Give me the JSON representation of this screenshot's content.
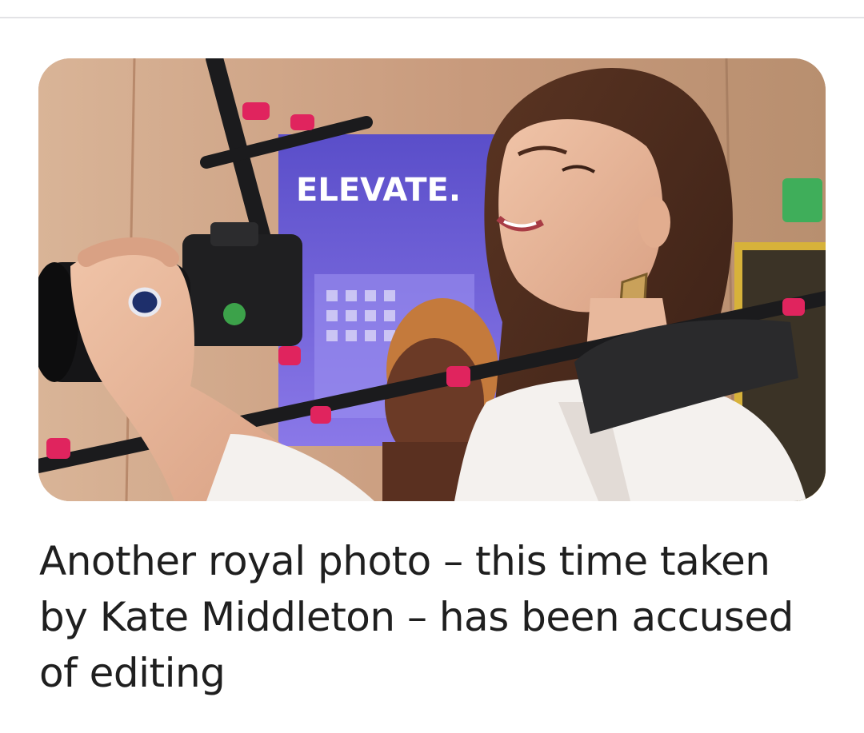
{
  "article": {
    "headline": "Another royal photo – this time taken by Kate Middleton – has been accused of editing",
    "image": {
      "icon": "news-photo",
      "banner_text": "ELEVATE."
    }
  },
  "colors": {
    "background": "#ffffff",
    "divider": "#e3e3e6",
    "headline_text": "#1f1f1f",
    "banner": "#6f5fd8",
    "rig_accent": "#e0245e"
  }
}
